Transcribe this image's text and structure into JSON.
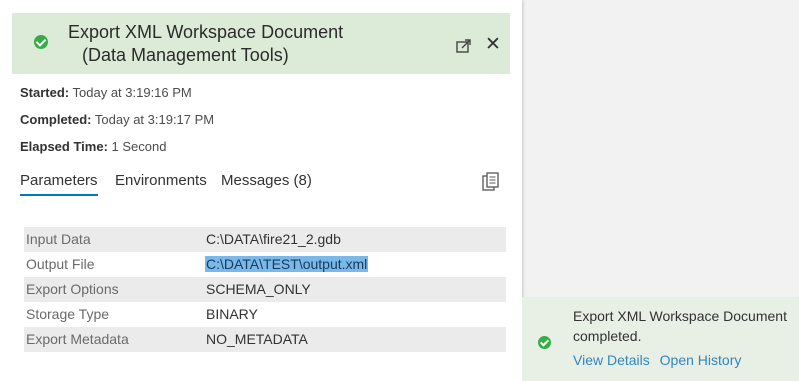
{
  "header": {
    "title_line1": "Export XML Workspace Document",
    "title_line2": "(Data Management Tools)",
    "status_icon": "success-check-icon",
    "status_color": "#35ac46"
  },
  "meta": {
    "started_label": "Started:",
    "started_value": "Today at 3:19:16 PM",
    "completed_label": "Completed:",
    "completed_value": "Today at 3:19:17 PM",
    "elapsed_label": "Elapsed Time:",
    "elapsed_value": "1 Second"
  },
  "tabs": [
    {
      "label": "Parameters",
      "active": true
    },
    {
      "label": "Environments",
      "active": false
    },
    {
      "label": "Messages (8)",
      "active": false
    }
  ],
  "parameters": [
    {
      "name": "Input Data",
      "value": "C:\\DATA\\fire21_2.gdb"
    },
    {
      "name": "Output File",
      "value": "C:\\DATA\\TEST\\output.xml",
      "selected": true
    },
    {
      "name": "Export Options",
      "value": "SCHEMA_ONLY"
    },
    {
      "name": "Storage Type",
      "value": "BINARY"
    },
    {
      "name": "Export Metadata",
      "value": "NO_METADATA"
    }
  ],
  "toast": {
    "message": "Export XML Workspace Document completed.",
    "view_details": "View Details",
    "open_history": "Open History",
    "link_color": "#2f86c4"
  },
  "colors": {
    "header_bg": "#dcebd7",
    "tab_accent": "#0079c1",
    "selection": "#79b8e9"
  }
}
